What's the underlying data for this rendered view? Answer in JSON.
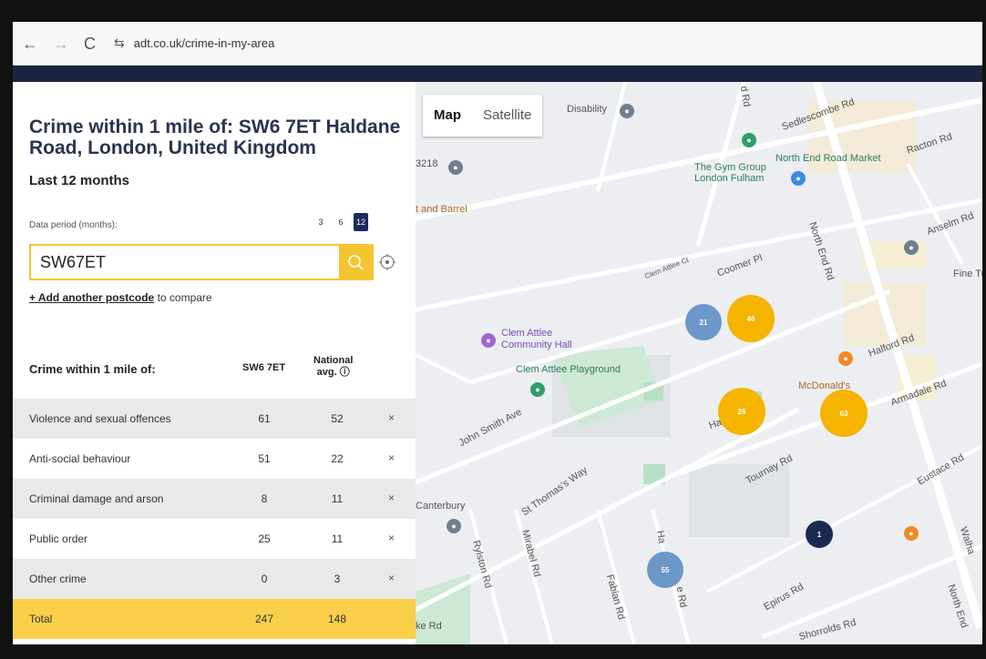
{
  "browser": {
    "back_glyph": "←",
    "forward_glyph": "→",
    "reload_glyph": "C",
    "site_settings_glyph": "⇆",
    "url": "adt.co.uk/crime-in-my-area"
  },
  "panel": {
    "title": "Crime within 1 mile of: SW6 7ET Haldane Road, London, United Kingdom",
    "subtitle": "Last 12 months",
    "period_label": "Data period (months):",
    "period_options": [
      "3",
      "6",
      "12"
    ],
    "period_selected": "12",
    "search_value": "SW67ET",
    "add_postcode_link": "+ Add another postcode",
    "add_postcode_suffix": " to compare"
  },
  "table": {
    "headers": [
      "Crime within 1 mile of:",
      "SW6 7ET",
      "National",
      "avg."
    ],
    "rows": [
      {
        "label": "Violence and sexual offences",
        "local": "61",
        "national": "52",
        "remove": "×"
      },
      {
        "label": "Anti-social behaviour",
        "local": "51",
        "national": "22",
        "remove": "×"
      },
      {
        "label": "Criminal damage and arson",
        "local": "8",
        "national": "11",
        "remove": "×"
      },
      {
        "label": "Public order",
        "local": "25",
        "national": "11",
        "remove": "×"
      },
      {
        "label": "Other crime",
        "local": "0",
        "national": "3",
        "remove": "×"
      }
    ],
    "total": {
      "label": "Total",
      "local": "247",
      "national": "148"
    }
  },
  "map": {
    "type_map": "Map",
    "type_satellite": "Satellite",
    "labels": {
      "disability": "Disability",
      "r3218": "3218",
      "barrel": "t and Barrel",
      "gym": "The Gym Group\nLondon Fulham",
      "market": "North End Road Market",
      "racton": "Racton Rd",
      "sedlescombe": "Sedlescombe Rd",
      "anselm": "Anselm Rd",
      "fine": "Fine Tu",
      "clem_ct": "Clem Attlee Ct",
      "coomer": "Coomer Pl",
      "north_end_1": "North End Rd",
      "halford": "Halford Rd",
      "hall": "Clem Attlee\nCommunity Hall",
      "playground": "Clem Attlee Playground",
      "mcdonalds": "McDonald's",
      "armadale": "Armadale Rd",
      "john_smith": "John Smith Ave",
      "st_thomas": "St Thomas's Way",
      "tournay": "Tournay Rd",
      "eustace": "Eustace Rd",
      "canterbury": "Canterbury",
      "rylston": "Rylston Rd",
      "mirabel": "Mirabel Rd",
      "fabian": "Fabian Rd",
      "epirus": "Epirus Rd",
      "shorrolds": "Shorrolds Rd",
      "north_end_2": "North End",
      "walham": "Walha",
      "ke_rd": "ke Rd",
      "ha": "Ha",
      "ha_rd": "Ha",
      "e_rd": "e Rd",
      "rd_top": "d Rd"
    },
    "clusters": [
      {
        "id": "c21",
        "count": "21",
        "color": "#6b97c9"
      },
      {
        "id": "c46",
        "count": "46",
        "color": "#f4b400"
      },
      {
        "id": "c26",
        "count": "26",
        "color": "#f4b400"
      },
      {
        "id": "c63",
        "count": "63",
        "color": "#f4b400"
      },
      {
        "id": "c1",
        "count": "1",
        "color": "#1b2a50"
      },
      {
        "id": "c55",
        "count": "55",
        "color": "#6b97c9"
      }
    ]
  }
}
